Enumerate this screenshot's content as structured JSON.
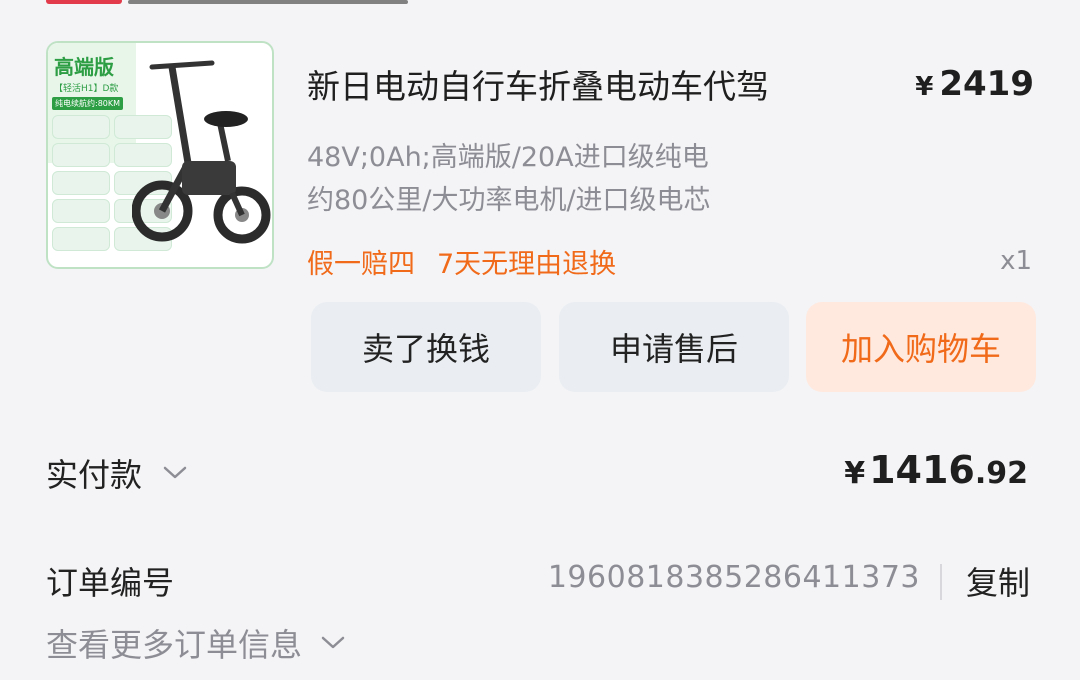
{
  "product": {
    "image_badge_title": "高端版",
    "image_badge_sub": "【轻活H1】D款",
    "image_badge_sub2": "纯电续航约:80KM",
    "title": "新日电动自行车折叠电动车代驾",
    "price_symbol": "¥",
    "price": "2419",
    "spec_line1": "48V;0Ah;高端版/20A进口级纯电",
    "spec_line2": "约80公里/大功率电机/进口级电芯",
    "tags": [
      "假一赔四",
      "7天无理由退换"
    ],
    "quantity": "x1"
  },
  "actions": {
    "sell_label": "卖了换钱",
    "after_sales_label": "申请售后",
    "add_cart_label": "加入购物车"
  },
  "payment": {
    "label": "实付款",
    "symbol": "¥",
    "amount_int": "1416",
    "amount_dec": ".92"
  },
  "order": {
    "number_label": "订单编号",
    "number": "1960818385286411373",
    "copy_label": "复制",
    "more_label": "查看更多订单信息"
  },
  "colors": {
    "accent": "#f06a1a",
    "brand_green": "#2e9e45",
    "muted_text": "#8d8d95"
  }
}
